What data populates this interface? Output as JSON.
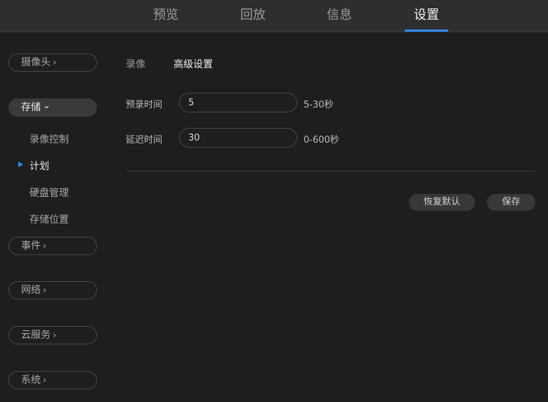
{
  "topnav": {
    "tabs": [
      {
        "label": "预览"
      },
      {
        "label": "回放"
      },
      {
        "label": "信息"
      },
      {
        "label": "设置"
      }
    ],
    "active_tab": "设置",
    "accent_color": "#2d8cf0"
  },
  "sidebar": {
    "groups": [
      {
        "label": "摄像头",
        "chevron": "›"
      },
      {
        "label": "存储",
        "chevron": "⌄"
      },
      {
        "label": "事件",
        "chevron": "›"
      },
      {
        "label": "网络",
        "chevron": "›"
      },
      {
        "label": "云服务",
        "chevron": "›"
      },
      {
        "label": "系统",
        "chevron": "›"
      }
    ],
    "storage_items": [
      {
        "label": "录像控制"
      },
      {
        "label": "计划"
      },
      {
        "label": "硬盘管理"
      },
      {
        "label": "存储位置"
      }
    ],
    "active_item": "计划"
  },
  "content": {
    "tabs": [
      {
        "label": "录像"
      },
      {
        "label": "高级设置"
      }
    ],
    "active_tab": "高级设置",
    "fields": [
      {
        "label": "预录时间",
        "value": "5",
        "hint": "5-30秒"
      },
      {
        "label": "延迟时间",
        "value": "30",
        "hint": "0-600秒"
      }
    ],
    "buttons": {
      "restore_label": "恢复默认",
      "save_label": "保存"
    }
  }
}
